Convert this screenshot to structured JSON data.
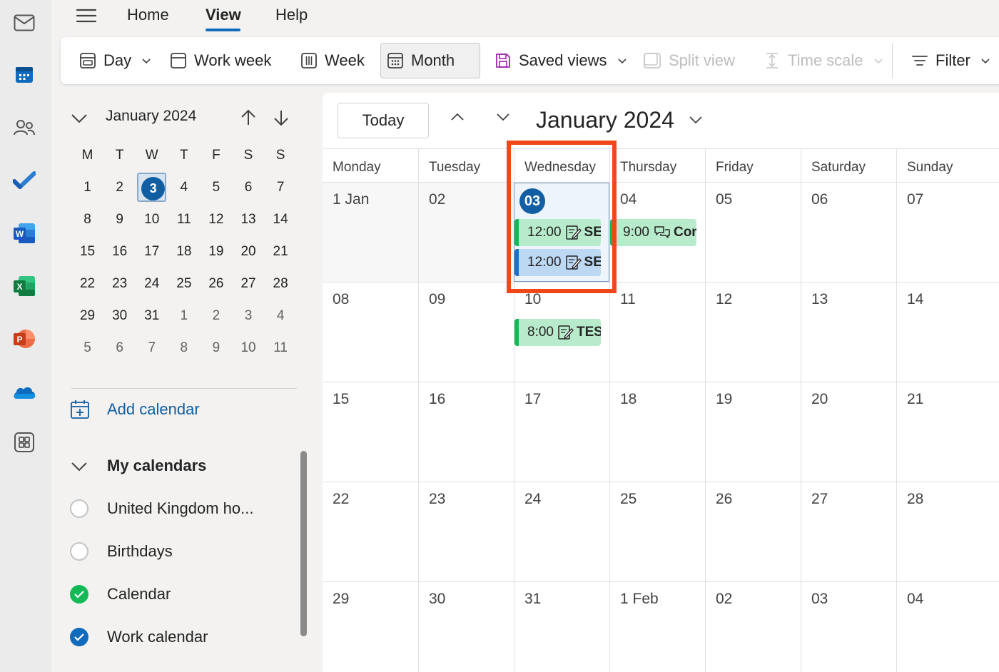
{
  "rail": {
    "items": [
      {
        "name": "mail-icon"
      },
      {
        "name": "calendar-app-icon"
      },
      {
        "name": "people-icon"
      },
      {
        "name": "todo-icon"
      },
      {
        "name": "word-icon"
      },
      {
        "name": "excel-icon"
      },
      {
        "name": "powerpoint-icon"
      },
      {
        "name": "onedrive-icon"
      },
      {
        "name": "apps-icon"
      }
    ]
  },
  "topmenu": {
    "tabs": [
      {
        "label": "Home"
      },
      {
        "label": "View"
      },
      {
        "label": "Help"
      }
    ],
    "active_tab": "View"
  },
  "ribbon": {
    "day": "Day",
    "work_week": "Work week",
    "week": "Week",
    "month": "Month",
    "saved_views": "Saved views",
    "split_view": "Split view",
    "time_scale": "Time scale",
    "filter": "Filter",
    "active": "Month"
  },
  "mini_calendar": {
    "title": "January 2024",
    "weekdays": [
      "M",
      "T",
      "W",
      "T",
      "F",
      "S",
      "S"
    ],
    "weeks": [
      [
        "1",
        "2",
        "3",
        "4",
        "5",
        "6",
        "7"
      ],
      [
        "8",
        "9",
        "10",
        "11",
        "12",
        "13",
        "14"
      ],
      [
        "15",
        "16",
        "17",
        "18",
        "19",
        "20",
        "21"
      ],
      [
        "22",
        "23",
        "24",
        "25",
        "26",
        "27",
        "28"
      ],
      [
        "29",
        "30",
        "31",
        "1",
        "2",
        "3",
        "4"
      ],
      [
        "5",
        "6",
        "7",
        "8",
        "9",
        "10",
        "11"
      ]
    ],
    "today": "3"
  },
  "left_pane": {
    "add_calendar": "Add calendar",
    "my_calendars": "My calendars",
    "calendars": [
      {
        "label": "United Kingdom ho...",
        "checked": false,
        "color": "#c4c4c4"
      },
      {
        "label": "Birthdays",
        "checked": false,
        "color": "#c4c4c4"
      },
      {
        "label": "Calendar",
        "checked": true,
        "color": "#13b956"
      },
      {
        "label": "Work calendar",
        "checked": true,
        "color": "#0f6cbd"
      }
    ]
  },
  "main": {
    "today_button": "Today",
    "title": "January 2024",
    "weekdays": [
      "Monday",
      "Tuesday",
      "Wednesday",
      "Thursday",
      "Friday",
      "Saturday",
      "Sunday"
    ],
    "weeks": [
      [
        "1 Jan",
        "02",
        "03",
        "04",
        "05",
        "06",
        "07"
      ],
      [
        "08",
        "09",
        "10",
        "11",
        "12",
        "13",
        "14"
      ],
      [
        "15",
        "16",
        "17",
        "18",
        "19",
        "20",
        "21"
      ],
      [
        "22",
        "23",
        "24",
        "25",
        "26",
        "27",
        "28"
      ],
      [
        "29",
        "30",
        "31",
        "1 Feb",
        "02",
        "03",
        "04"
      ]
    ],
    "events": [
      {
        "time": "12:00",
        "title": "SE",
        "color": "green",
        "icon": "edit-note-icon"
      },
      {
        "time": "12:00",
        "title": "SE",
        "color": "blue",
        "icon": "edit-note-icon"
      },
      {
        "time": "9:00",
        "title": "Cor",
        "color": "green",
        "icon": "chat-icon"
      },
      {
        "time": "8:00",
        "title": "TES",
        "color": "green",
        "icon": "edit-note-icon"
      }
    ]
  },
  "colors": {
    "accent": "#0f6cbd",
    "today_fill": "#115ea3",
    "highlight": "#f0481a"
  }
}
